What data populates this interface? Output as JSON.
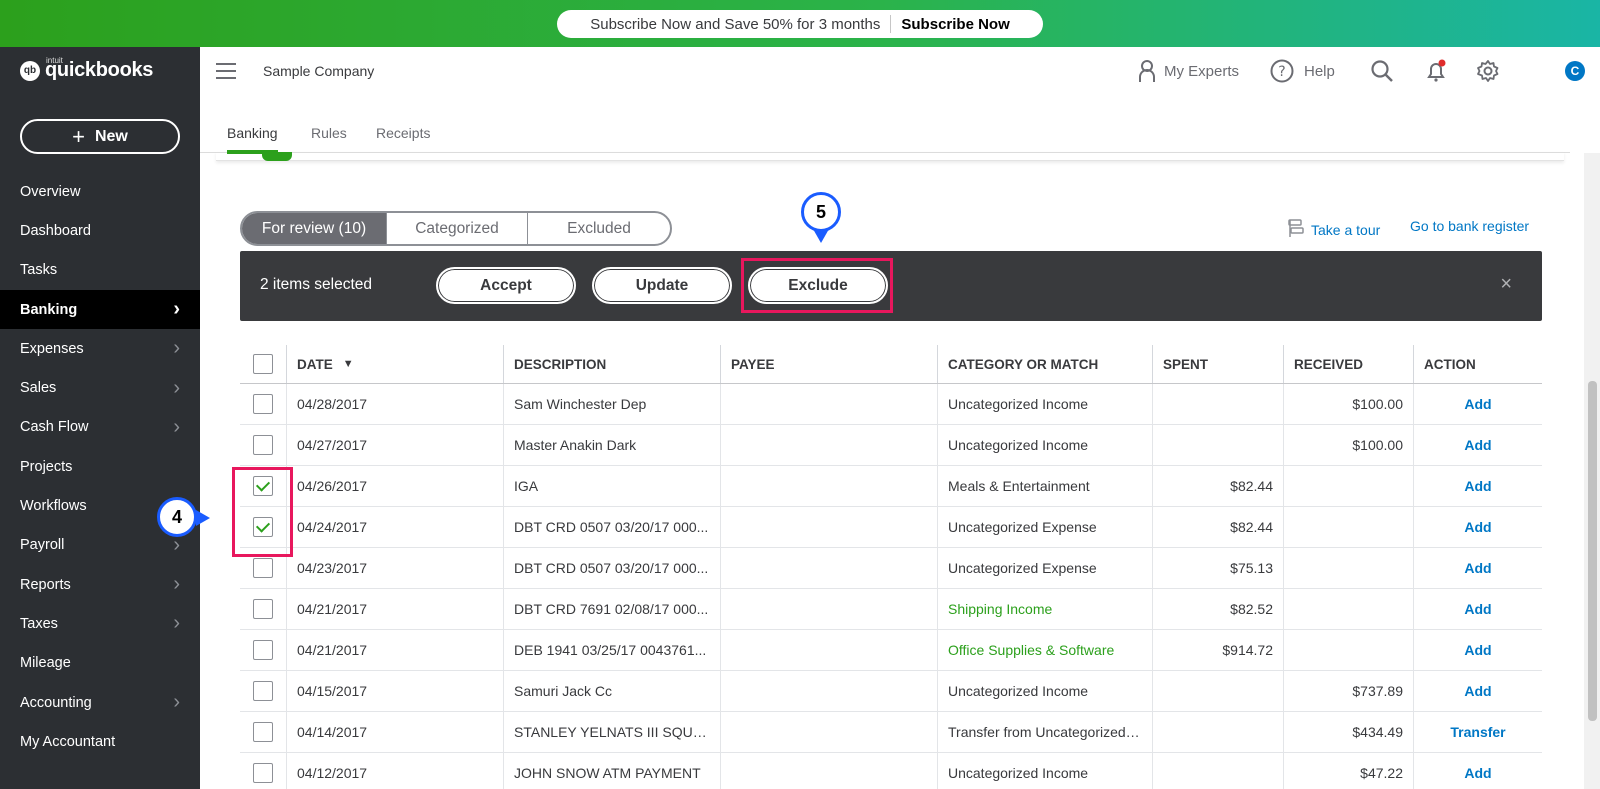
{
  "promo": {
    "text": "Subscribe Now and Save 50% for 3 months",
    "cta": "Subscribe Now"
  },
  "brand": {
    "mark": "qb",
    "intuit": "intuit",
    "name": "quickbooks"
  },
  "sidebar": {
    "new_label": "New",
    "items": [
      {
        "label": "Overview",
        "chevron": false
      },
      {
        "label": "Dashboard",
        "chevron": false
      },
      {
        "label": "Tasks",
        "chevron": false
      },
      {
        "label": "Banking",
        "chevron": true,
        "active": true
      },
      {
        "label": "Expenses",
        "chevron": true
      },
      {
        "label": "Sales",
        "chevron": true
      },
      {
        "label": "Cash Flow",
        "chevron": true
      },
      {
        "label": "Projects",
        "chevron": false
      },
      {
        "label": "Workflows",
        "chevron": false
      },
      {
        "label": "Payroll",
        "chevron": true
      },
      {
        "label": "Reports",
        "chevron": true
      },
      {
        "label": "Taxes",
        "chevron": true
      },
      {
        "label": "Mileage",
        "chevron": false
      },
      {
        "label": "Accounting",
        "chevron": true
      },
      {
        "label": "My Accountant",
        "chevron": false
      }
    ]
  },
  "header": {
    "company": "Sample Company",
    "my_experts": "My Experts",
    "help": "Help",
    "avatar": "C"
  },
  "subtabs": [
    "Banking",
    "Rules",
    "Receipts"
  ],
  "review_tabs": [
    "For review (10)",
    "Categorized",
    "Excluded"
  ],
  "links": {
    "tour": "Take a tour",
    "register": "Go to bank register"
  },
  "actionbar": {
    "selected": "2 items selected",
    "accept": "Accept",
    "update": "Update",
    "exclude": "Exclude",
    "close": "×"
  },
  "annotations": {
    "step4": "4",
    "step5": "5"
  },
  "table": {
    "headers": {
      "date": "DATE",
      "description": "DESCRIPTION",
      "payee": "PAYEE",
      "category": "CATEGORY OR MATCH",
      "spent": "SPENT",
      "received": "RECEIVED",
      "action": "ACTION"
    },
    "rows": [
      {
        "date": "04/28/2017",
        "description": "Sam Winchester Dep",
        "payee": "",
        "category": "Uncategorized Income",
        "spent": "",
        "received": "$100.00",
        "action": "Add",
        "checked": false,
        "green": false
      },
      {
        "date": "04/27/2017",
        "description": "Master Anakin Dark",
        "payee": "",
        "category": "Uncategorized Income",
        "spent": "",
        "received": "$100.00",
        "action": "Add",
        "checked": false,
        "green": false
      },
      {
        "date": "04/26/2017",
        "description": "IGA",
        "payee": "",
        "category": "Meals & Entertainment",
        "spent": "$82.44",
        "received": "",
        "action": "Add",
        "checked": true,
        "green": false
      },
      {
        "date": "04/24/2017",
        "description": "DBT CRD 0507 03/20/17 000...",
        "payee": "",
        "category": "Uncategorized Expense",
        "spent": "$82.44",
        "received": "",
        "action": "Add",
        "checked": true,
        "green": false
      },
      {
        "date": "04/23/2017",
        "description": "DBT CRD 0507 03/20/17 000...",
        "payee": "",
        "category": "Uncategorized Expense",
        "spent": "$75.13",
        "received": "",
        "action": "Add",
        "checked": false,
        "green": false
      },
      {
        "date": "04/21/2017",
        "description": "DBT CRD 7691 02/08/17 000...",
        "payee": "",
        "category": "Shipping Income",
        "spent": "$82.52",
        "received": "",
        "action": "Add",
        "checked": false,
        "green": true
      },
      {
        "date": "04/21/2017",
        "description": "DEB 1941 03/25/17 0043761...",
        "payee": "",
        "category": "Office Supplies & Software",
        "spent": "$914.72",
        "received": "",
        "action": "Add",
        "checked": false,
        "green": true
      },
      {
        "date": "04/15/2017",
        "description": "Samuri Jack Cc",
        "payee": "",
        "category": "Uncategorized Income",
        "spent": "",
        "received": "$737.89",
        "action": "Add",
        "checked": false,
        "green": false
      },
      {
        "date": "04/14/2017",
        "description": "STANLEY YELNATS III SQUAR...",
        "payee": "",
        "category": "Transfer from Uncategorized Ass",
        "spent": "",
        "received": "$434.49",
        "action": "Transfer",
        "checked": false,
        "green": false
      },
      {
        "date": "04/12/2017",
        "description": "JOHN SNOW ATM PAYMENT",
        "payee": "",
        "category": "Uncategorized Income",
        "spent": "",
        "received": "$47.22",
        "action": "Add",
        "checked": false,
        "green": false
      }
    ]
  },
  "colors": {
    "brand_green": "#2ca01c",
    "link_blue": "#0077c5",
    "sidebar_bg": "#2c2f33",
    "highlight": "#e8175d",
    "badge_border": "#1a5cff"
  }
}
